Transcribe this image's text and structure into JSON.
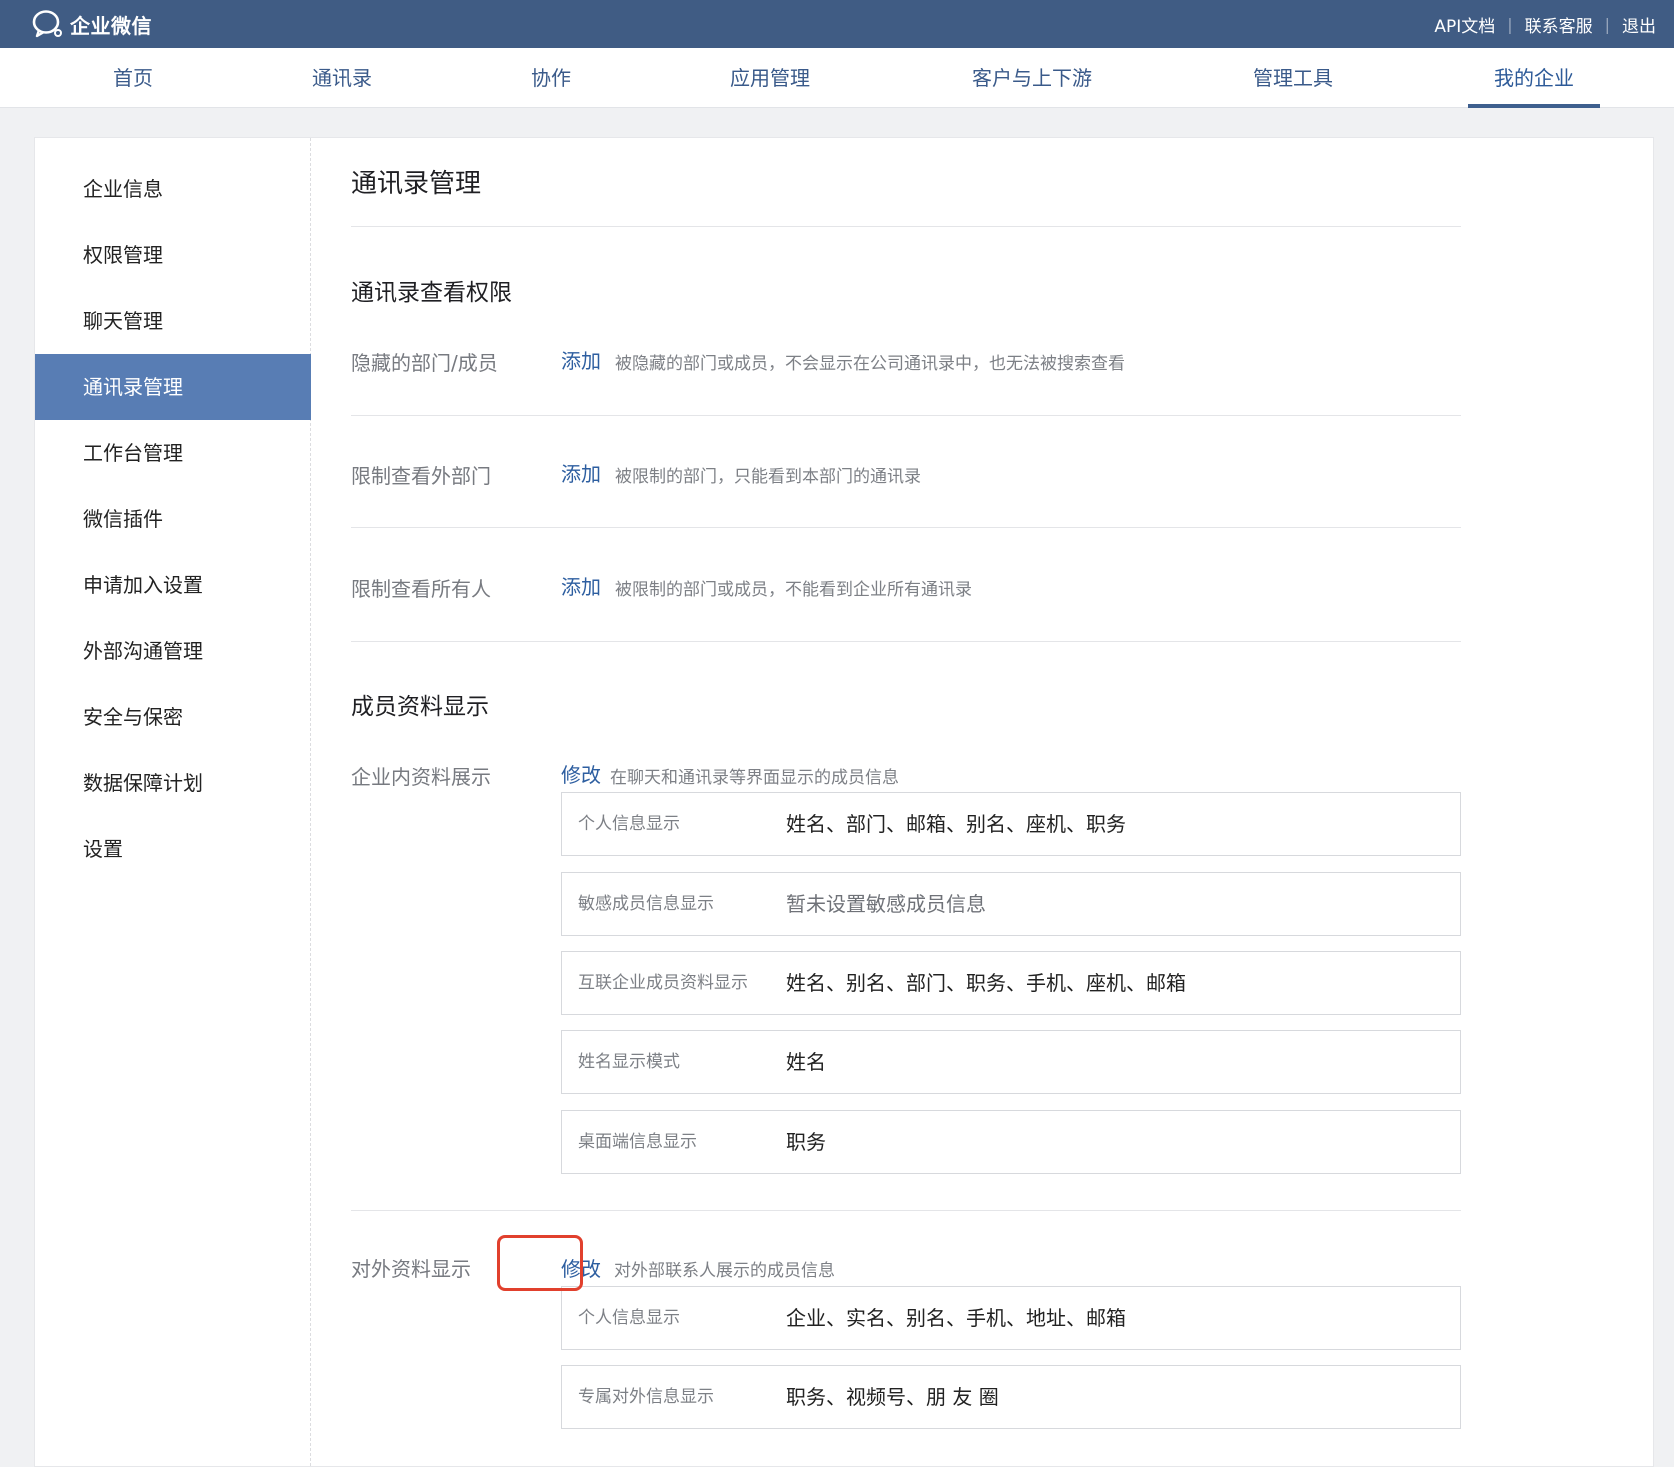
{
  "topbar": {
    "logo_text": "企业微信",
    "links": [
      "API文档",
      "联系客服",
      "退出"
    ]
  },
  "nav": {
    "items": [
      "首页",
      "通讯录",
      "协作",
      "应用管理",
      "客户与上下游",
      "管理工具",
      "我的企业"
    ],
    "active": "我的企业"
  },
  "sidebar": {
    "items": [
      "企业信息",
      "权限管理",
      "聊天管理",
      "通讯录管理",
      "工作台管理",
      "微信插件",
      "申请加入设置",
      "外部沟通管理",
      "安全与保密",
      "数据保障计划",
      "设置"
    ],
    "active": "通讯录管理"
  },
  "main": {
    "title": "通讯录管理",
    "view_perm": {
      "title": "通讯录查看权限",
      "rows": [
        {
          "label": "隐藏的部门/成员",
          "action": "添加",
          "desc": "被隐藏的部门或成员，不会显示在公司通讯录中，也无法被搜索查看"
        },
        {
          "label": "限制查看外部门",
          "action": "添加",
          "desc": "被限制的部门，只能看到本部门的通讯录"
        },
        {
          "label": "限制查看所有人",
          "action": "添加",
          "desc": "被限制的部门或成员，不能看到企业所有通讯录"
        }
      ]
    },
    "profile": {
      "title": "成员资料显示",
      "internal": {
        "label": "企业内资料展示",
        "action": "修改",
        "desc": "在聊天和通讯录等界面显示的成员信息",
        "items": [
          {
            "key": "个人信息显示",
            "value": "姓名、部门、邮箱、别名、座机、职务"
          },
          {
            "key": "敏感成员信息显示",
            "value": "暂未设置敏感成员信息"
          },
          {
            "key": "互联企业成员资料显示",
            "value": "姓名、别名、部门、职务、手机、座机、邮箱"
          },
          {
            "key": "姓名显示模式",
            "value": "姓名"
          },
          {
            "key": "桌面端信息显示",
            "value": "职务"
          }
        ]
      },
      "external": {
        "label": "对外资料显示",
        "action": "修改",
        "desc": "对外部联系人展示的成员信息",
        "items": [
          {
            "key": "个人信息显示",
            "value": "企业、实名、别名、手机、地址、邮箱"
          },
          {
            "key": "专属对外信息显示",
            "value": "职务、视频号、朋 友 圈"
          }
        ]
      }
    }
  },
  "colors": {
    "topbar": "#405c84",
    "accent": "#2d5ea0",
    "sidebar_active": "#587db4",
    "highlight": "#e1402d"
  }
}
